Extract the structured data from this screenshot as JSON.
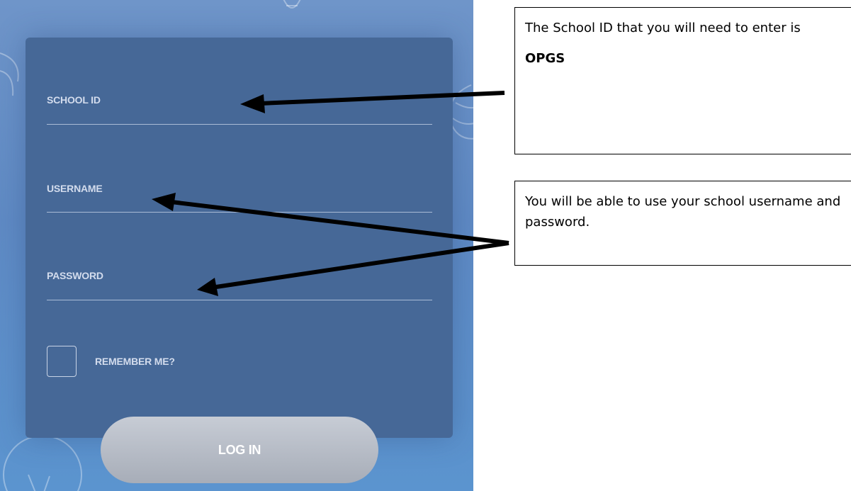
{
  "login_form": {
    "school_id_label": "SCHOOL ID",
    "username_label": "USERNAME",
    "password_label": "PASSWORD",
    "remember_label": "REMEMBER ME?",
    "remember_checked": false,
    "login_button": "LOG IN"
  },
  "callouts": {
    "school_id": {
      "text": "The School ID that you will need to enter is",
      "code": "OPGS"
    },
    "credentials": {
      "text": "You will be able to use your school username and password."
    }
  },
  "colors": {
    "background_blue": "#5f8ac4",
    "card_blue": "#466897",
    "button_gray": "#b3b9c3"
  }
}
